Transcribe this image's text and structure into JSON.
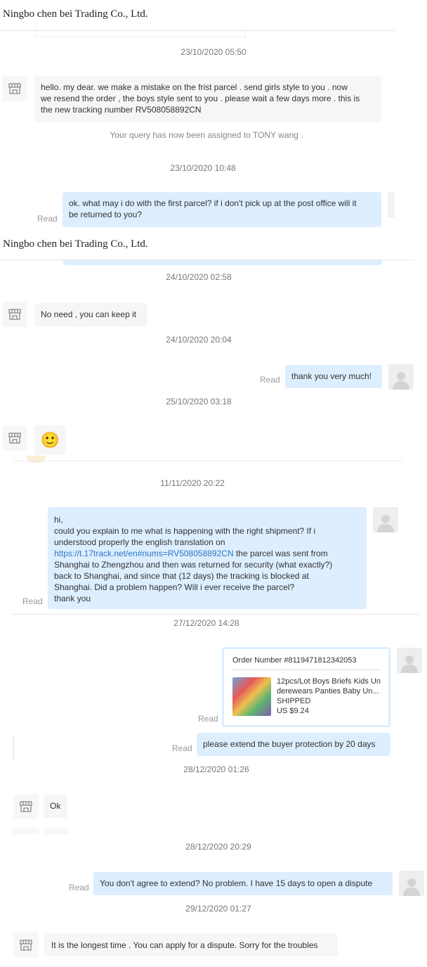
{
  "header": {
    "seller_name": "Ningbo chen bei Trading Co., Ltd."
  },
  "conversation": [
    {
      "timestamp": "23/10/2020 05:50"
    },
    {
      "from": "seller",
      "text_lines": [
        "hello. my dear. we make a mistake on the frist parcel . send girls style to you . now",
        "we resend the order , the boys style sent to you . please wait a few days more . this is",
        "the new tracking number RV508058892CN"
      ]
    },
    {
      "system": "Your query has now been assigned to TONY wang ."
    },
    {
      "timestamp": "23/10/2020 10:48"
    },
    {
      "from": "buyer",
      "status": "Read",
      "text_lines": [
        "ok. what may i do with the first parcel? if i don't pick up at the post office will it",
        "be returned to you?"
      ]
    },
    {
      "timestamp": "24/10/2020 02:58"
    },
    {
      "from": "seller",
      "text": "No need , you can keep it"
    },
    {
      "timestamp": "24/10/2020 20:04"
    },
    {
      "from": "buyer",
      "status": "Read",
      "text": "thank you very much!"
    },
    {
      "timestamp": "25/10/2020 03:18"
    },
    {
      "from": "seller",
      "emoji": "🙂"
    },
    {
      "timestamp": "11/11/2020 20:22"
    },
    {
      "from": "buyer",
      "status": "Read",
      "text_lines": [
        "hi,",
        "could you explain to me what is happening with the right shipment? If i",
        "understood properly the english translation on"
      ],
      "link": "https://t.17track.net/en#nums=RV508058892CN",
      "after_link": " the parcel was sent from",
      "text_lines_2": [
        "Shanghai to Zhengzhou and then was returned for security (what exactly?)",
        "back to Shanghai, and since that (12 days) the tracking is blocked at",
        "Shanghai. Did a problem happen? Will i ever receive the parcel?",
        "thank you"
      ]
    },
    {
      "timestamp": "27/12/2020 14:28"
    },
    {
      "from": "buyer",
      "status": "Read",
      "order": {
        "number_label": "Order Number #8119471812342053",
        "title_line1": "12pcs/Lot Boys Briefs Kids Un",
        "title_line2": "derewears Panties Baby Un...",
        "status": "SHIPPED",
        "price": "US $9.24"
      }
    },
    {
      "from": "buyer",
      "status": "Read",
      "text": "please extend the buyer protection by 20 days"
    },
    {
      "timestamp": "28/12/2020 01:26"
    },
    {
      "from": "seller",
      "text": "Ok"
    },
    {
      "timestamp": "28/12/2020 20:29"
    },
    {
      "from": "buyer",
      "status": "Read",
      "text": "You don't agree to extend? No problem. I have 15 days to open a dispute"
    },
    {
      "timestamp": "29/12/2020 01:27"
    },
    {
      "from": "seller",
      "text": "It is the longest time . You can apply for a dispute. Sorry for the troubles"
    }
  ],
  "colors": {
    "outgoing_bubble": "#ddeeff",
    "incoming_bubble": "#f6f6f6",
    "link": "#2a77c4"
  },
  "icons": {
    "seller_avatar": "shop-icon",
    "buyer_avatar": "user-icon"
  }
}
